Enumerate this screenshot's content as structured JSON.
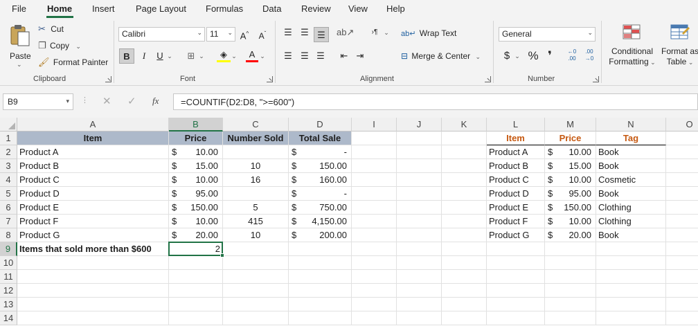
{
  "menu": {
    "tabs": [
      "File",
      "Home",
      "Insert",
      "Page Layout",
      "Formulas",
      "Data",
      "Review",
      "View",
      "Help"
    ],
    "active": "Home"
  },
  "ribbon": {
    "clipboard": {
      "paste": "Paste",
      "cut": "Cut",
      "copy": "Copy",
      "format_painter": "Format Painter",
      "label": "Clipboard"
    },
    "font": {
      "name": "Calibri",
      "size": "11",
      "label": "Font",
      "bold": "B",
      "italic": "I",
      "underline": "U"
    },
    "alignment": {
      "wrap_text": "Wrap Text",
      "merge_center": "Merge & Center",
      "label": "Alignment"
    },
    "number": {
      "format": "General",
      "currency": "$",
      "percent": "%",
      "comma": "❜",
      "label": "Number",
      "inc_decimal": "←0 .00",
      "dec_decimal": ".00 →0"
    },
    "styles": {
      "conditional": "Conditional",
      "formatting": "Formatting",
      "format_as": "Format as",
      "table": "Table"
    }
  },
  "formula_bar": {
    "name_box": "B9",
    "fx": "fx",
    "formula": "=COUNTIF(D2:D8, \">=600\")"
  },
  "columns": [
    "A",
    "B",
    "C",
    "D",
    "I",
    "J",
    "K",
    "L",
    "M",
    "N",
    "O"
  ],
  "rows": [
    "1",
    "2",
    "3",
    "4",
    "5",
    "6",
    "7",
    "8",
    "9",
    "10",
    "11",
    "12",
    "13",
    "14"
  ],
  "sheet": {
    "headers": {
      "item": "Item",
      "price": "Price",
      "number_sold": "Number Sold",
      "total_sale": "Total Sale"
    },
    "products": [
      {
        "item": "Product A",
        "price": "10.00",
        "sold": "",
        "total": "-"
      },
      {
        "item": "Product B",
        "price": "15.00",
        "sold": "10",
        "total": "150.00"
      },
      {
        "item": "Product C",
        "price": "10.00",
        "sold": "16",
        "total": "160.00"
      },
      {
        "item": "Product D",
        "price": "95.00",
        "sold": "",
        "total": "-"
      },
      {
        "item": "Product E",
        "price": "150.00",
        "sold": "5",
        "total": "750.00"
      },
      {
        "item": "Product F",
        "price": "10.00",
        "sold": "415",
        "total": "4,150.00"
      },
      {
        "item": "Product G",
        "price": "20.00",
        "sold": "10",
        "total": "200.00"
      }
    ],
    "summary_label": "Items that sold more than $600",
    "summary_value": "2",
    "currency_symbol": "$",
    "side_headers": {
      "item": "Item",
      "price": "Price",
      "tag": "Tag"
    },
    "side_table": [
      {
        "item": "Product A",
        "price": "10.00",
        "tag": "Book"
      },
      {
        "item": "Product B",
        "price": "15.00",
        "tag": "Book"
      },
      {
        "item": "Product C",
        "price": "10.00",
        "tag": "Cosmetic"
      },
      {
        "item": "Product D",
        "price": "95.00",
        "tag": "Book"
      },
      {
        "item": "Product E",
        "price": "150.00",
        "tag": "Clothing"
      },
      {
        "item": "Product F",
        "price": "10.00",
        "tag": "Clothing"
      },
      {
        "item": "Product G",
        "price": "20.00",
        "tag": "Book"
      }
    ]
  },
  "colors": {
    "accent": "#217346",
    "header_fill": "#adb9ca",
    "orange_header": "#c65911"
  }
}
